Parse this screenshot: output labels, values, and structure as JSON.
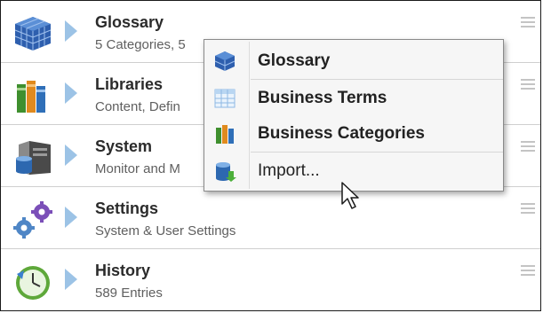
{
  "rows": [
    {
      "title": "Glossary",
      "subtitle": "5 Categories, 5",
      "icon": "cube-grid-icon"
    },
    {
      "title": "Libraries",
      "subtitle": "Content, Defin",
      "icon": "books-icon"
    },
    {
      "title": "System",
      "subtitle": "Monitor and M",
      "icon": "server-icon"
    },
    {
      "title": "Settings",
      "subtitle": "System & User Settings",
      "icon": "gears-icon"
    },
    {
      "title": "History",
      "subtitle": "589 Entries",
      "icon": "clock-icon"
    }
  ],
  "popup": {
    "items": [
      {
        "label": "Glossary",
        "icon": "cube-grid-icon"
      },
      {
        "label": "Business Terms",
        "icon": "table-icon"
      },
      {
        "label": "Business Categories",
        "icon": "books-icon"
      },
      {
        "label": "Import...",
        "icon": "database-import-icon"
      }
    ]
  },
  "colors": {
    "chevron": "#9cc3e6",
    "cube": "#2e5fae",
    "separator": "#cfcfcf"
  }
}
